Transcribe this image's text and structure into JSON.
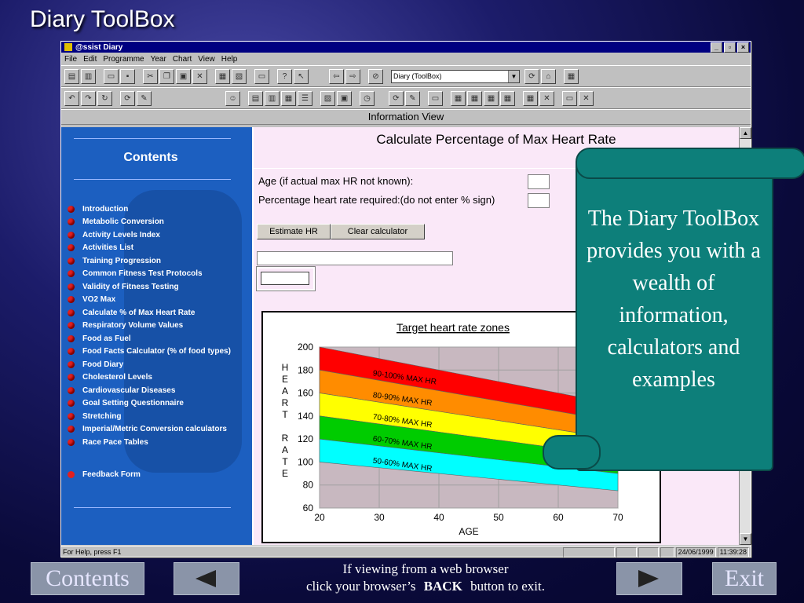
{
  "slide": {
    "title": "Diary ToolBox"
  },
  "window": {
    "title": "@ssist Diary",
    "controls": [
      "_",
      "▫",
      "×"
    ],
    "menu": [
      "File",
      "Edit",
      "Programme",
      "Year",
      "Chart",
      "View",
      "Help"
    ],
    "combo_value": "Diary (ToolBox)",
    "info_view": "Information View"
  },
  "sidebar": {
    "heading": "Contents",
    "items": [
      "Introduction",
      "Metabolic Conversion",
      "Activity Levels Index",
      "Activities List",
      "Training Progression",
      "Common Fitness Test Protocols",
      "Validity of Fitness Testing",
      "VO2 Max",
      "Calculate % of Max Heart Rate",
      "Respiratory Volume Values",
      "Food as Fuel",
      "Food Facts Calculator (% of food types)",
      "Food Diary",
      "Cholesterol Levels",
      "Cardiovascular Diseases",
      "Goal Setting Questionnaire",
      "Stretching",
      "Imperial/Metric Conversion calculators",
      "Race Pace Tables"
    ],
    "feedback": "Feedback Form"
  },
  "calculator": {
    "title": "Calculate Percentage of Max Heart Rate",
    "age_label": "Age (if actual max HR not known):",
    "percent_label": "Percentage heart rate required:(do not enter % sign)",
    "estimate_button": "Estimate HR",
    "clear_button": "Clear calculator"
  },
  "chart_data": {
    "type": "area",
    "title": "Target heart rate zones",
    "xlabel": "AGE",
    "ylabel": "HEART RATE",
    "x": [
      20,
      70
    ],
    "xticks": [
      20,
      30,
      40,
      50,
      60,
      70
    ],
    "yticks": [
      60,
      80,
      100,
      120,
      140,
      160,
      180,
      200
    ],
    "xlim": [
      20,
      70
    ],
    "ylim": [
      60,
      200
    ],
    "bands": [
      {
        "name": "90-100% MAX HR",
        "lower": [
          180,
          135
        ],
        "upper": [
          200,
          150
        ],
        "color": "#ff0000"
      },
      {
        "name": "80-90% MAX HR",
        "lower": [
          160,
          120
        ],
        "upper": [
          180,
          135
        ],
        "color": "#ff8c00"
      },
      {
        "name": "70-80% MAX HR",
        "lower": [
          140,
          105
        ],
        "upper": [
          160,
          120
        ],
        "color": "#ffff00"
      },
      {
        "name": "60-70% MAX HR",
        "lower": [
          120,
          90
        ],
        "upper": [
          140,
          105
        ],
        "color": "#00cc00"
      },
      {
        "name": "50-60% MAX HR",
        "lower": [
          100,
          75
        ],
        "upper": [
          120,
          90
        ],
        "color": "#00ffff"
      }
    ],
    "plot_bg": "#c8b8c0",
    "grid": true
  },
  "status": {
    "help": "For Help, press F1",
    "date": "24/06/1999",
    "time": "11:39:28"
  },
  "callout": {
    "text": "The Diary ToolBox provides you with a wealth of information, calculators and examples"
  },
  "nav": {
    "contents": "Contents",
    "exit": "Exit",
    "note_line1": "If viewing from a web browser",
    "note_line2_pre": "click your browser’s",
    "note_back": "BACK",
    "note_line2_post": "button to exit."
  }
}
